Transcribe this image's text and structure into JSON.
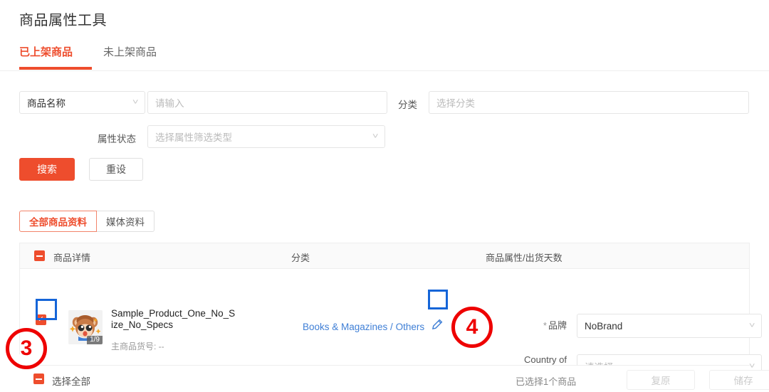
{
  "header": {
    "title": "商品属性工具",
    "tabs": [
      {
        "label": "已上架商品",
        "active": true
      },
      {
        "label": "未上架商品",
        "active": false
      }
    ]
  },
  "filters": {
    "name_select_value": "商品名称",
    "name_input_placeholder": "请输入",
    "category_label": "分类",
    "category_input_placeholder": "选择分类",
    "attr_status_label": "属性状态",
    "attr_status_placeholder": "选择属性筛选类型",
    "search_button": "搜索",
    "reset_button": "重设"
  },
  "segmented": {
    "items": [
      {
        "label": "全部商品资料",
        "active": true
      },
      {
        "label": "媒体资料",
        "active": false
      }
    ]
  },
  "table": {
    "columns": {
      "detail": "商品详情",
      "category": "分类",
      "attributes": "商品属性/出货天数"
    },
    "rows": [
      {
        "selected": true,
        "image_count_badge": "1/9",
        "product_name": "Sample_Product_One_No_Size_No_Specs",
        "sku_label": "主商品货号: --",
        "category_path": "Books & Magazines / Others",
        "edit_icon": "pencil-icon",
        "attributes": [
          {
            "required_marker": "*",
            "label": "品牌",
            "value": "NoBrand",
            "is_placeholder": false
          },
          {
            "required_marker": "",
            "label": "Country of Origin",
            "value": "请选择",
            "is_placeholder": true
          }
        ]
      }
    ]
  },
  "footer": {
    "select_all_label": "选择全部",
    "selection_count_text": "已选择1个商品",
    "restore_button": "复原",
    "save_button": "储存"
  },
  "annotations": [
    {
      "id": "3",
      "kind": "step-marker"
    },
    {
      "id": "4",
      "kind": "step-marker"
    }
  ],
  "colors": {
    "accent": "#ee4d2d",
    "link": "#3f7fd6",
    "annotation_red": "#ee0000",
    "annotation_blue": "#1565d8"
  }
}
